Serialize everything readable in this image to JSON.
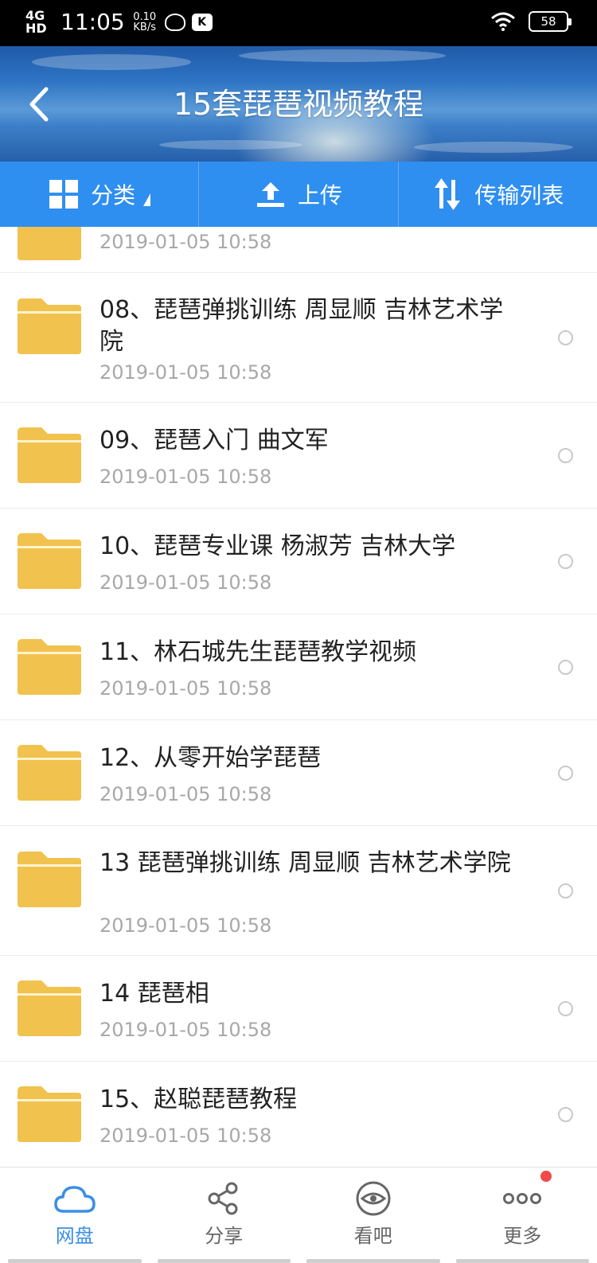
{
  "status_bar": {
    "network": "4G HD",
    "time": "11:05",
    "speed": "0.10 KB/s",
    "battery": "58",
    "k_badge": "K"
  },
  "header": {
    "title": "15套琵琶视频教程"
  },
  "toolbar": {
    "category_label": "分类",
    "upload_label": "上传",
    "transfer_label": "传输列表"
  },
  "list": {
    "partial_item_date": "2019-01-05  10:58",
    "items": [
      {
        "name": "08、琵琶弹挑训练 周显顺 吉林艺术学院",
        "date": "2019-01-05  10:58"
      },
      {
        "name": "09、琵琶入门 曲文军",
        "date": "2019-01-05  10:58"
      },
      {
        "name": "10、琵琶专业课 杨淑芳 吉林大学",
        "date": "2019-01-05  10:58"
      },
      {
        "name": "11、林石城先生琵琶教学视频",
        "date": "2019-01-05  10:58"
      },
      {
        "name": "12、从零开始学琵琶",
        "date": "2019-01-05  10:58"
      },
      {
        "name": "13 琵琶弹挑训练 周显顺 吉林艺术学院",
        "date": "2019-01-05  10:58"
      },
      {
        "name": "14  琵琶相",
        "date": "2019-01-05  10:58"
      },
      {
        "name": "15、赵聪琵琶教程",
        "date": "2019-01-05  10:58"
      }
    ]
  },
  "bottom_nav": {
    "items": [
      {
        "label": "网盘",
        "icon": "cloud-icon",
        "active": true
      },
      {
        "label": "分享",
        "icon": "share-icon",
        "active": false
      },
      {
        "label": "看吧",
        "icon": "eye-icon",
        "active": false
      },
      {
        "label": "更多",
        "icon": "more-icon",
        "active": false,
        "badge": true
      }
    ]
  },
  "colors": {
    "accent": "#2f8ff0",
    "folder": "#f1c24e",
    "active_nav": "#3a8ee6",
    "badge": "#f04a4a"
  }
}
